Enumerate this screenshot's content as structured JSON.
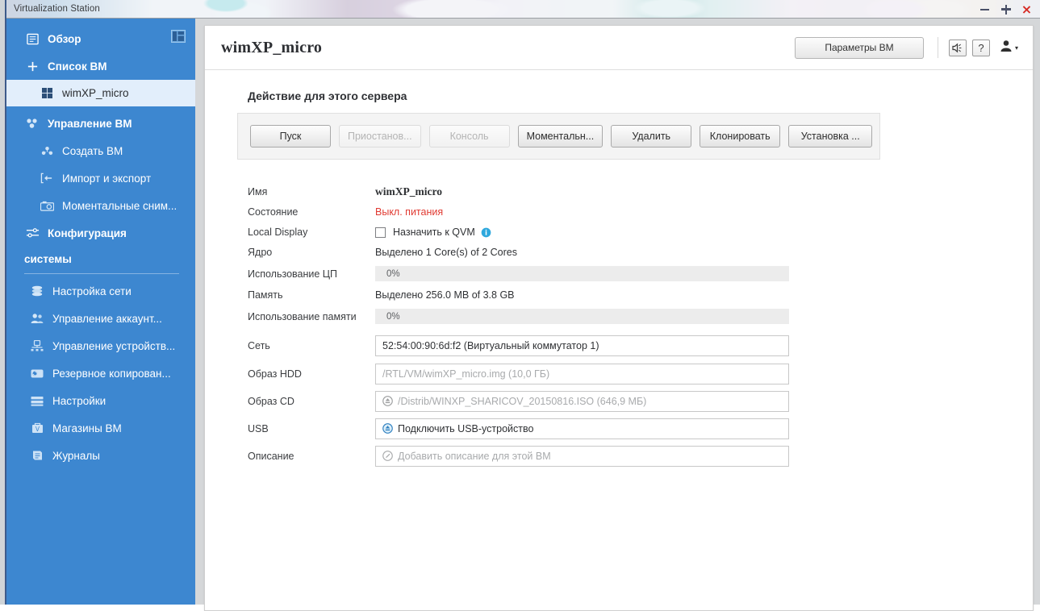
{
  "window": {
    "title": "Virtualization Station",
    "controls": {
      "minimize": "minimize-icon",
      "maximize": "maximize-icon",
      "close": "×"
    }
  },
  "sidebar": {
    "overview": {
      "label": "Обзор",
      "icon": "overview-icon"
    },
    "panel_toggle_icon": "panel-layout-icon",
    "vm_list": {
      "label": "Список ВМ",
      "icon": "plus-icon"
    },
    "active_vm": {
      "label": "wimXP_micro",
      "icon": "grid-icon"
    },
    "groups": [
      {
        "label": "Управление ВМ",
        "icon": "vm-manage-icon",
        "items": [
          {
            "label": "Создать ВМ",
            "icon": "create-vm-icon"
          },
          {
            "label": "Импорт и экспорт",
            "icon": "import-export-icon"
          },
          {
            "label": "Моментальные сним...",
            "icon": "snapshot-camera-icon"
          }
        ]
      }
    ],
    "configuration": {
      "label": "Конфигурация",
      "icon": "sliders-icon"
    },
    "system_label": "системы",
    "system_items": [
      {
        "label": "Настройка сети",
        "icon": "network-icon"
      },
      {
        "label": "Управление аккаунт...",
        "icon": "accounts-icon"
      },
      {
        "label": "Управление устройств...",
        "icon": "devices-icon"
      },
      {
        "label": "Резервное копирован...",
        "icon": "backup-icon"
      },
      {
        "label": "Настройки",
        "icon": "settings-icon"
      },
      {
        "label": "Магазины ВМ",
        "icon": "vm-store-icon"
      },
      {
        "label": "Журналы",
        "icon": "logs-icon"
      }
    ]
  },
  "header": {
    "vm_title": "wimXP_micro",
    "vm_params_button": "Параметры ВМ",
    "speaker_icon": "speaker-icon",
    "help_label": "?",
    "user_icon": "user-avatar-icon",
    "user_caret": "▾"
  },
  "main": {
    "section_title": "Действие для этого сервера",
    "actions": [
      {
        "label": "Пуск",
        "disabled": false
      },
      {
        "label": "Приостанов...",
        "disabled": true
      },
      {
        "label": "Консоль",
        "disabled": true
      },
      {
        "label": "Моментальн...",
        "disabled": false
      },
      {
        "label": "Удалить",
        "disabled": false
      },
      {
        "label": "Клонировать",
        "disabled": false
      },
      {
        "label": "Установка ...",
        "disabled": false
      }
    ]
  },
  "details": {
    "name": {
      "label": "Имя",
      "value": "wimXP_micro"
    },
    "state": {
      "label": "Состояние",
      "value": "Выкл. питания",
      "color": "#e03a32"
    },
    "local_display": {
      "label": "Local Display",
      "checkbox_label": "Назначить к QVM",
      "checked": false,
      "info_icon": "info-icon"
    },
    "core": {
      "label": "Ядро",
      "value": "Выделено 1 Core(s) of 2 Cores"
    },
    "cpu_usage": {
      "label": "Использование ЦП",
      "value": "0%",
      "percent": 0
    },
    "memory": {
      "label": "Память",
      "value": "Выделено 256.0 MB of 3.8 GB"
    },
    "memory_usage": {
      "label": "Использование памяти",
      "value": "0%",
      "percent": 0
    },
    "network": {
      "label": "Сеть",
      "value": "52:54:00:90:6d:f2 (Виртуальный коммутатор 1)"
    },
    "hdd_image": {
      "label": "Образ HDD",
      "value": "/RTL/VM/wimXP_micro.img (10,0 ГБ)"
    },
    "cd_image": {
      "label": "Образ CD",
      "value": "/Distrib/WINXP_SHARICOV_20150816.ISO (646,9 МБ)",
      "icon": "eject-icon"
    },
    "usb": {
      "label": "USB",
      "value": "Подключить USB-устройство",
      "icon": "eject-usb-icon"
    },
    "description": {
      "label": "Описание",
      "placeholder": "Добавить описание для этой ВМ",
      "icon": "pencil-icon"
    }
  }
}
